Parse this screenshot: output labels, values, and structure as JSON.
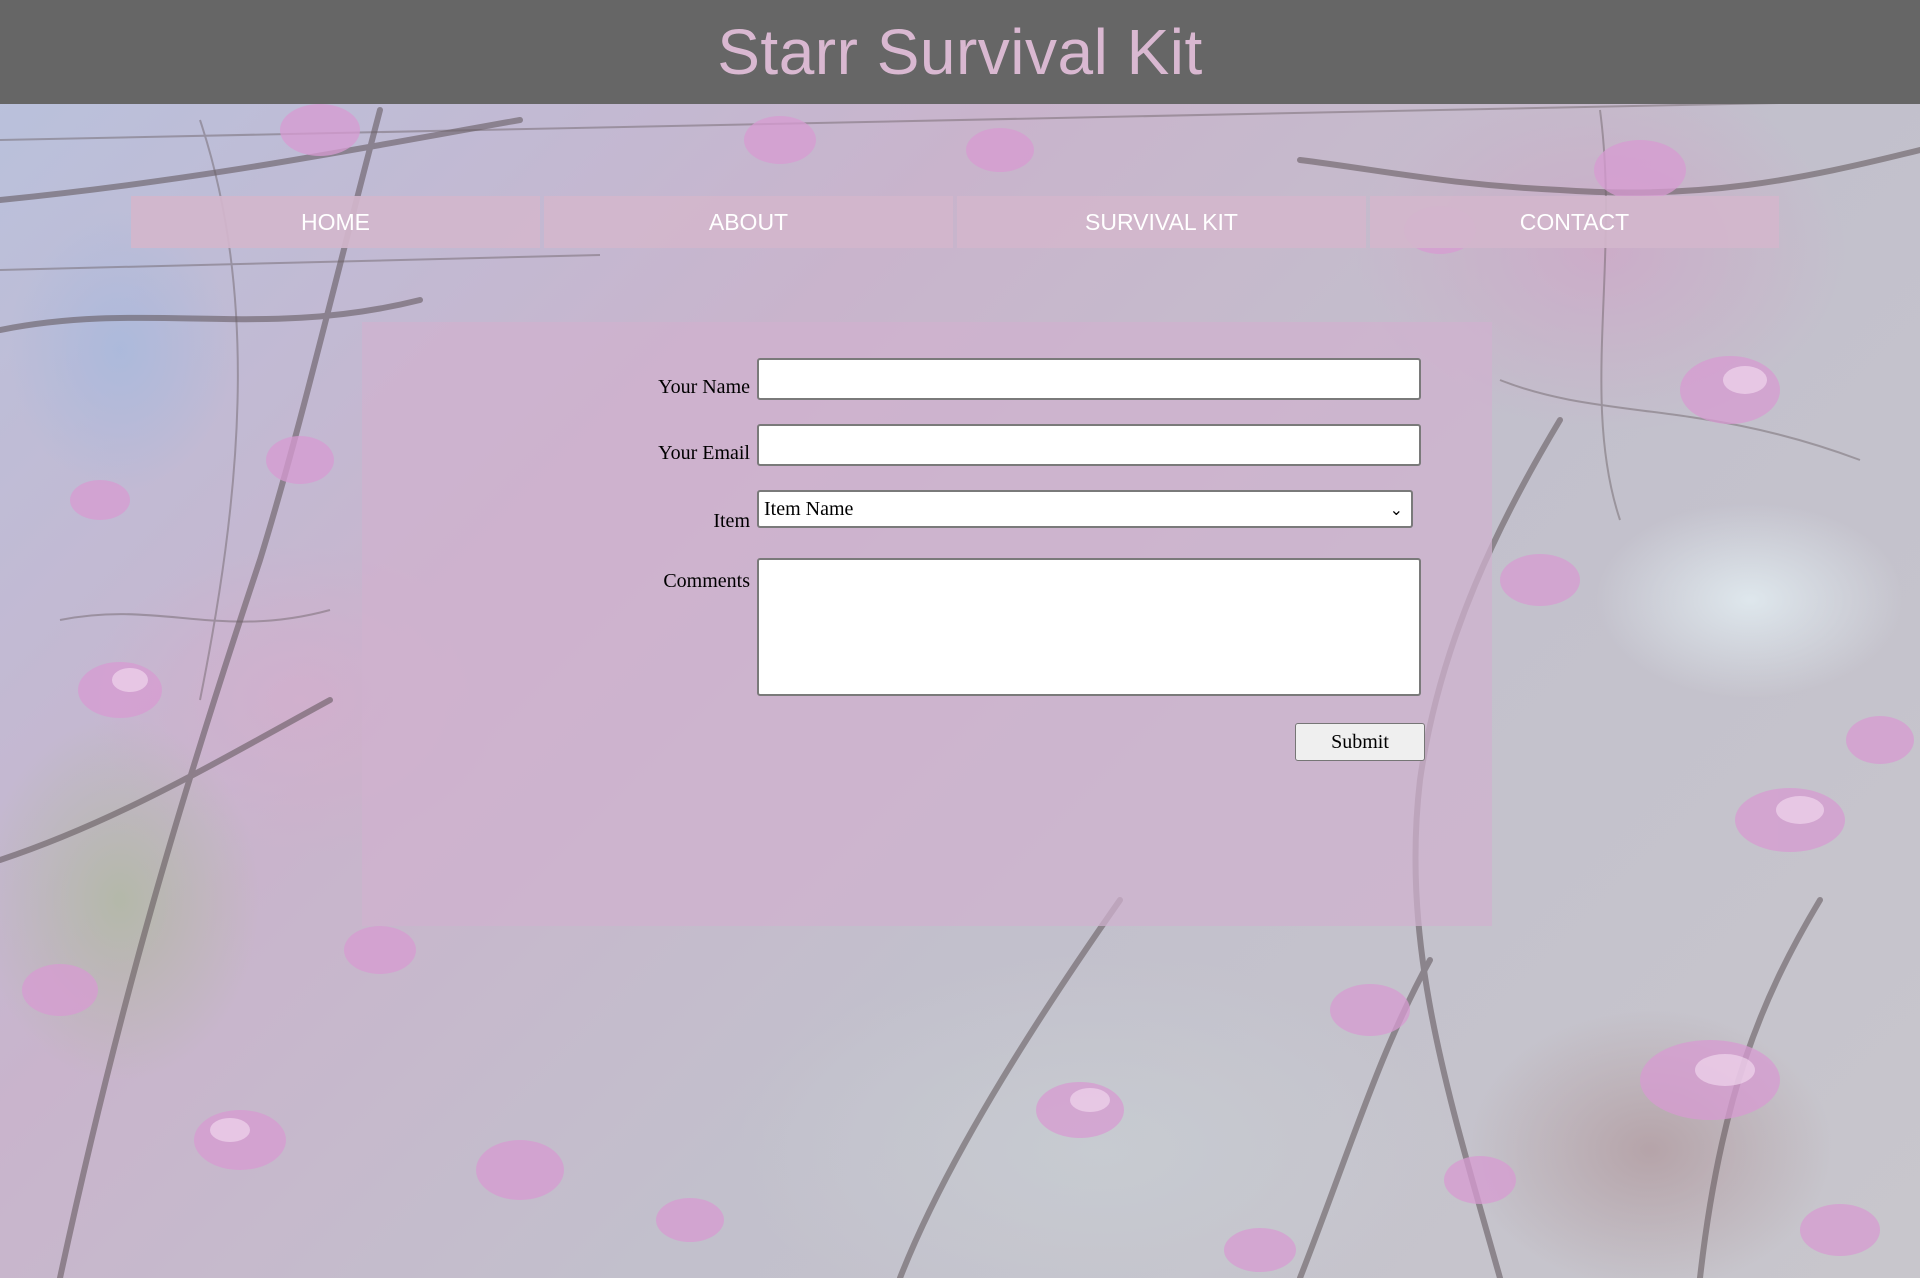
{
  "header": {
    "title": "Starr Survival Kit"
  },
  "nav": {
    "items": [
      {
        "label": "HOME"
      },
      {
        "label": "ABOUT"
      },
      {
        "label": "SURVIVAL KIT"
      },
      {
        "label": "CONTACT"
      }
    ]
  },
  "form": {
    "name": {
      "label": "Your Name",
      "value": ""
    },
    "email": {
      "label": "Your Email",
      "value": ""
    },
    "item": {
      "label": "Item",
      "selected": "Item Name"
    },
    "comments": {
      "label": "Comments",
      "value": ""
    },
    "submit_label": "Submit"
  },
  "colors": {
    "header_bg": "#666666",
    "title": "#d9b8d1",
    "nav_bg": "#d2b6cc",
    "panel_bg": "#d0b2ce"
  },
  "icons": {
    "select_arrow": "chevron-down-icon",
    "textarea_resize": "resize-handle-icon"
  }
}
